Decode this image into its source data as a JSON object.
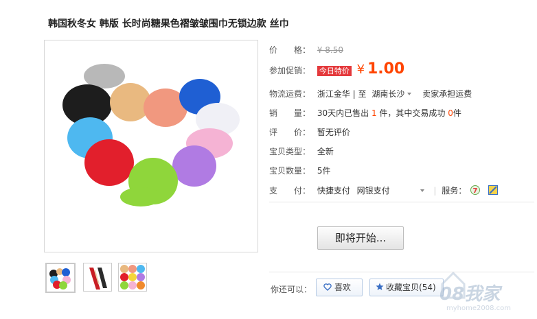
{
  "product": {
    "title": "韩国秋冬女 韩版 长时尚糖果色褶皱皱围巾无锁边款 丝巾"
  },
  "price": {
    "label": "价　　格：",
    "original": "¥ 8.50",
    "promo_label": "参加促销：",
    "promo_badge": "今日特价",
    "currency": "¥",
    "promo_value": "1.00"
  },
  "shipping": {
    "label": "物流运费：",
    "from": "浙江金华",
    "sep": "|",
    "to_prefix": "至",
    "to": "湖南长沙",
    "fee": "卖家承担运费"
  },
  "sales": {
    "label": "销　　量：",
    "prefix": "30天内已售出",
    "sold": "1",
    "mid": "件，其中交易成功",
    "success": "0",
    "suffix": "件"
  },
  "review": {
    "label": "评　　价：",
    "value": "暂无评价"
  },
  "type": {
    "label": "宝贝类型：",
    "value": "全新"
  },
  "qty": {
    "label": "宝贝数量：",
    "value": "5件"
  },
  "payment": {
    "label": "支　　付：",
    "methods": [
      "快捷支付",
      "网银支付"
    ],
    "service_label": "服务："
  },
  "actions": {
    "start_button": "即将开始...",
    "you_can": "你还可以：",
    "like_button": "喜欢",
    "collect_button": "收藏宝贝",
    "collect_count": "(54)"
  },
  "watermark": {
    "text": "08我家",
    "url": "myhome2008.com"
  },
  "colors": {
    "accent": "#ff4400",
    "badge": "#e4393c"
  }
}
